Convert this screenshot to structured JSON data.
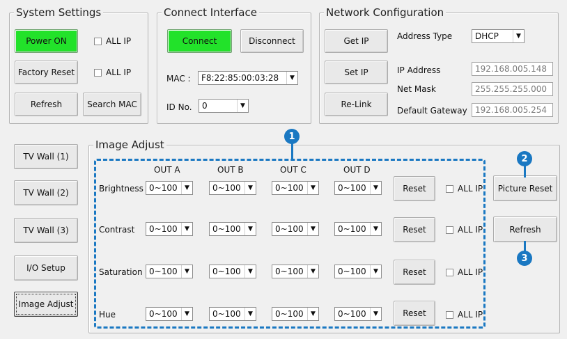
{
  "system_settings": {
    "title": "System Settings",
    "power_on": "Power ON",
    "all_ip_1": "ALL IP",
    "factory_reset": "Factory Reset",
    "all_ip_2": "ALL IP",
    "refresh": "Refresh",
    "search_mac": "Search MAC"
  },
  "connect_interface": {
    "title": "Connect Interface",
    "connect": "Connect",
    "disconnect": "Disconnect",
    "mac_label": "MAC :",
    "mac_value": "F8:22:85:00:03:28",
    "id_label": "ID No.",
    "id_value": "0"
  },
  "network": {
    "title": "Network Configuration",
    "get_ip": "Get IP",
    "set_ip": "Set IP",
    "relink": "Re-Link",
    "address_type_label": "Address Type",
    "address_type_value": "DHCP",
    "ip_label": "IP Address",
    "ip_value": "192.168.005.148",
    "mask_label": "Net Mask",
    "mask_value": "255.255.255.000",
    "gateway_label": "Default Gateway",
    "gateway_value": "192.168.005.254"
  },
  "nav": {
    "tv_wall_1": "TV Wall (1)",
    "tv_wall_2": "TV Wall (2)",
    "tv_wall_3": "TV Wall (3)",
    "io_setup": "I/O Setup",
    "image_adjust": "Image Adjust"
  },
  "image_adjust": {
    "title": "Image Adjust",
    "columns": [
      "OUT A",
      "OUT B",
      "OUT C",
      "OUT D"
    ],
    "rows": [
      {
        "label": "Brightness",
        "values": [
          "0~100",
          "0~100",
          "0~100",
          "0~100"
        ],
        "reset": "Reset",
        "all_ip": "ALL IP"
      },
      {
        "label": "Contrast",
        "values": [
          "0~100",
          "0~100",
          "0~100",
          "0~100"
        ],
        "reset": "Reset",
        "all_ip": "ALL IP"
      },
      {
        "label": "Saturation",
        "values": [
          "0~100",
          "0~100",
          "0~100",
          "0~100"
        ],
        "reset": "Reset",
        "all_ip": "ALL IP"
      },
      {
        "label": "Hue",
        "values": [
          "0~100",
          "0~100",
          "0~100",
          "0~100"
        ],
        "reset": "Reset",
        "all_ip": "ALL IP"
      }
    ],
    "picture_reset": "Picture Reset",
    "refresh": "Refresh"
  },
  "callouts": {
    "one": "1",
    "two": "2",
    "three": "3",
    "color": "#1a78c2"
  },
  "colors": {
    "power_on_bg": "#22e22a",
    "window_bg": "#f0f0f0"
  }
}
